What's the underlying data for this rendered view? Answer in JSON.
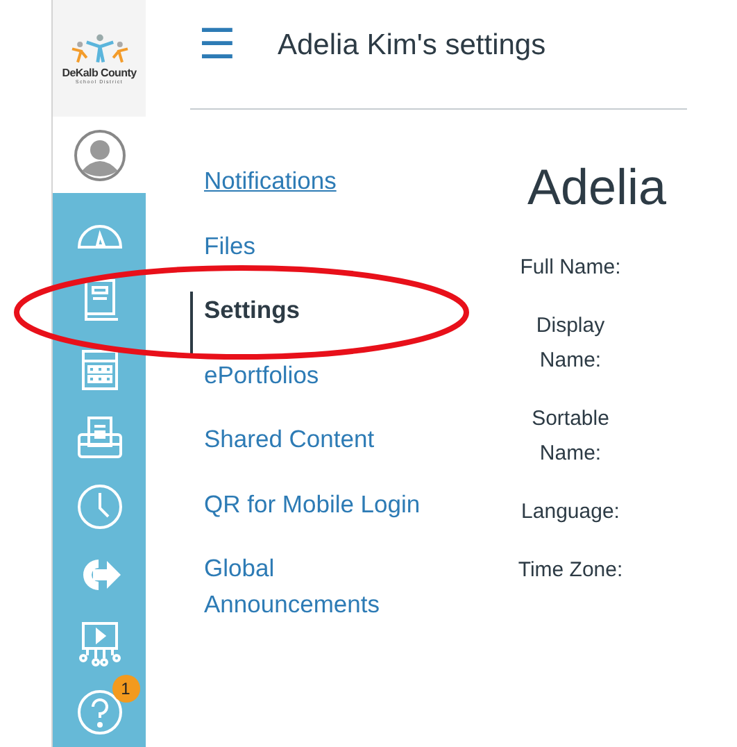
{
  "logo": {
    "name": "DeKalb County",
    "subtitle": "School District"
  },
  "sidebar": {
    "items": [
      {
        "kind": "dashboard"
      },
      {
        "kind": "courses"
      },
      {
        "kind": "calendar"
      },
      {
        "kind": "inbox"
      },
      {
        "kind": "history"
      },
      {
        "kind": "commons"
      },
      {
        "kind": "studio"
      },
      {
        "kind": "help",
        "badge": "1"
      }
    ]
  },
  "header": {
    "menu_icon": "☰",
    "title": "Adelia Kim's settings"
  },
  "nav": [
    {
      "label": "Notifications",
      "selected": false,
      "hovered": true
    },
    {
      "label": "Files",
      "selected": false,
      "hovered": false
    },
    {
      "label": "Settings",
      "selected": true,
      "hovered": false
    },
    {
      "label": "ePortfolios",
      "selected": false,
      "hovered": false
    },
    {
      "label": "Shared Content",
      "selected": false,
      "hovered": false
    },
    {
      "label": "QR for Mobile Login",
      "selected": false,
      "hovered": false
    },
    {
      "label": "Global Announcements",
      "selected": false,
      "hovered": false
    }
  ],
  "profile": {
    "heading": "Adelia",
    "fields": [
      "Full Name:",
      "Display Name:",
      "Sortable Name:",
      "Language:",
      "Time Zone:"
    ]
  }
}
